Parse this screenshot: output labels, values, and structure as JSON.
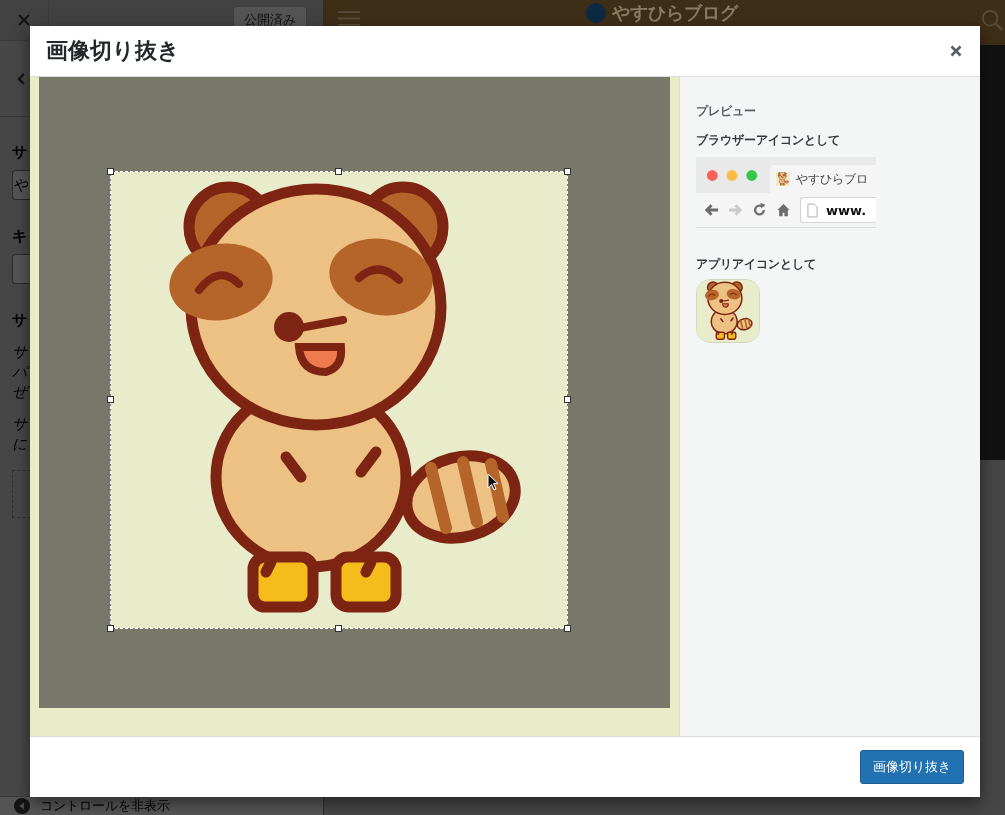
{
  "customizer": {
    "publish_button": "公開済み",
    "sidebar_fragments": [
      {
        "kind": "heading",
        "text": "サ"
      },
      {
        "kind": "field",
        "value": "や"
      },
      {
        "kind": "heading",
        "text": "キ"
      },
      {
        "kind": "field"
      },
      {
        "kind": "heading",
        "text": "サ"
      },
      {
        "kind": "text",
        "lines": [
          "サ",
          "パ",
          "ぜ"
        ]
      },
      {
        "kind": "text",
        "lines": [
          "サ",
          "に"
        ]
      },
      {
        "kind": "dropzone"
      }
    ],
    "hide_controls": "コントロールを非表示",
    "site_title": "やすひらブログ"
  },
  "modal": {
    "title": "画像切り抜き",
    "preview": {
      "heading": "プレビュー",
      "browser_label": "ブラウザーアイコンとして",
      "tab_title": "やすひらブロ",
      "address": "www.",
      "app_label": "アプリアイコンとして"
    },
    "crop_button": "画像切り抜き"
  }
}
